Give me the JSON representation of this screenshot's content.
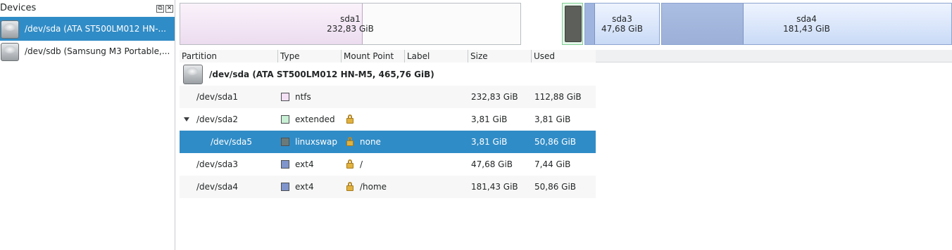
{
  "devices_panel": {
    "title": "Devices",
    "devices": [
      {
        "label": "/dev/sda (ATA ST500LM012 HN-...",
        "icon": "hard-disk-icon",
        "selected": true
      },
      {
        "label": "/dev/sdb (Samsung M3 Portable,...",
        "icon": "hard-disk-icon",
        "selected": false
      }
    ]
  },
  "partition_map": {
    "sda1": {
      "name": "sda1",
      "size": "232,83 GiB"
    },
    "sda3": {
      "name": "sda3",
      "size": "47,68 GiB"
    },
    "sda4": {
      "name": "sda4",
      "size": "181,43 GiB"
    }
  },
  "table": {
    "headers": [
      "Partition",
      "Type",
      "Mount Point",
      "Label",
      "Size",
      "Used"
    ],
    "device_row": "/dev/sda (ATA ST500LM012 HN-M5, 465,76 GiB)",
    "rows": [
      {
        "partition": "/dev/sda1",
        "type": "ntfs",
        "color": "#f4e1f5",
        "locked": false,
        "mount": "",
        "label": "",
        "size": "232,83 GiB",
        "used": "112,88 GiB"
      },
      {
        "partition": "/dev/sda2",
        "type": "extended",
        "color": "#c8f0d4",
        "locked": true,
        "mount": "",
        "label": "",
        "size": "3,81 GiB",
        "used": "3,81 GiB"
      },
      {
        "partition": "/dev/sda5",
        "type": "linuxswap",
        "color": "#6b7a78",
        "locked": true,
        "mount": "none",
        "label": "",
        "size": "3,81 GiB",
        "used": "50,86 GiB"
      },
      {
        "partition": "/dev/sda3",
        "type": "ext4",
        "color": "#7f95cb",
        "locked": true,
        "mount": "/",
        "label": "",
        "size": "47,68 GiB",
        "used": "7,44 GiB"
      },
      {
        "partition": "/dev/sda4",
        "type": "ext4",
        "color": "#7f95cb",
        "locked": true,
        "mount": "/home",
        "label": "",
        "size": "181,43 GiB",
        "used": "50,86 GiB"
      }
    ]
  },
  "colors": {
    "selection": "#308cc6",
    "selection_text": "#ffffff"
  }
}
